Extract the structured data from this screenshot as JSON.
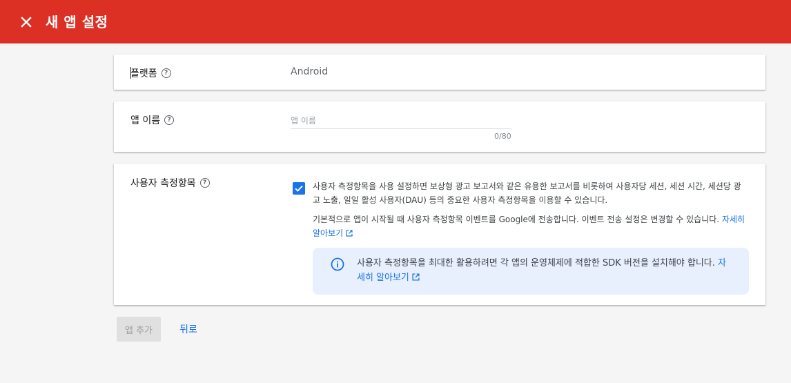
{
  "header": {
    "title": "새 앱 설정",
    "close_icon": "close-icon",
    "background_color": "#dc3025"
  },
  "platform": {
    "label": "플랫폼",
    "help_icon": "help-icon",
    "value": "Android"
  },
  "app_name": {
    "label": "앱 이름",
    "help_icon": "help-icon",
    "placeholder": "앱 이름",
    "value": "",
    "counter": "0/80"
  },
  "user_metrics": {
    "label": "사용자 측정항목",
    "help_icon": "help-icon",
    "checked": true,
    "description1": "사용자 측정항목을 사용 설정하면 보상형 광고 보고서와 같은 유용한 보고서를 비롯하여 사용자당 세션, 세션 시간, 세션당 광고 노출, 일일 활성 사용자(DAU) 등의 중요한 사용자 측정항목을 이용할 수 있습니다.",
    "description2": "기본적으로 앱이 시작될 때 사용자 측정항목 이벤트를 Google에 전송합니다. 이벤트 전송 설정은 변경할 수 있습니다.",
    "learn_more": "자세히 알아보기",
    "info": {
      "text": "사용자 측정항목을 최대한 활용하려면 각 앱의 운영체제에 적합한 SDK 버전을 설치해야 합니다.",
      "learn_more": "자세히 알아보기",
      "icon": "info-icon"
    }
  },
  "actions": {
    "add_app": "앱 추가",
    "back": "뒤로"
  },
  "colors": {
    "accent": "#1a73e8",
    "info_background": "#e8f0fe"
  }
}
